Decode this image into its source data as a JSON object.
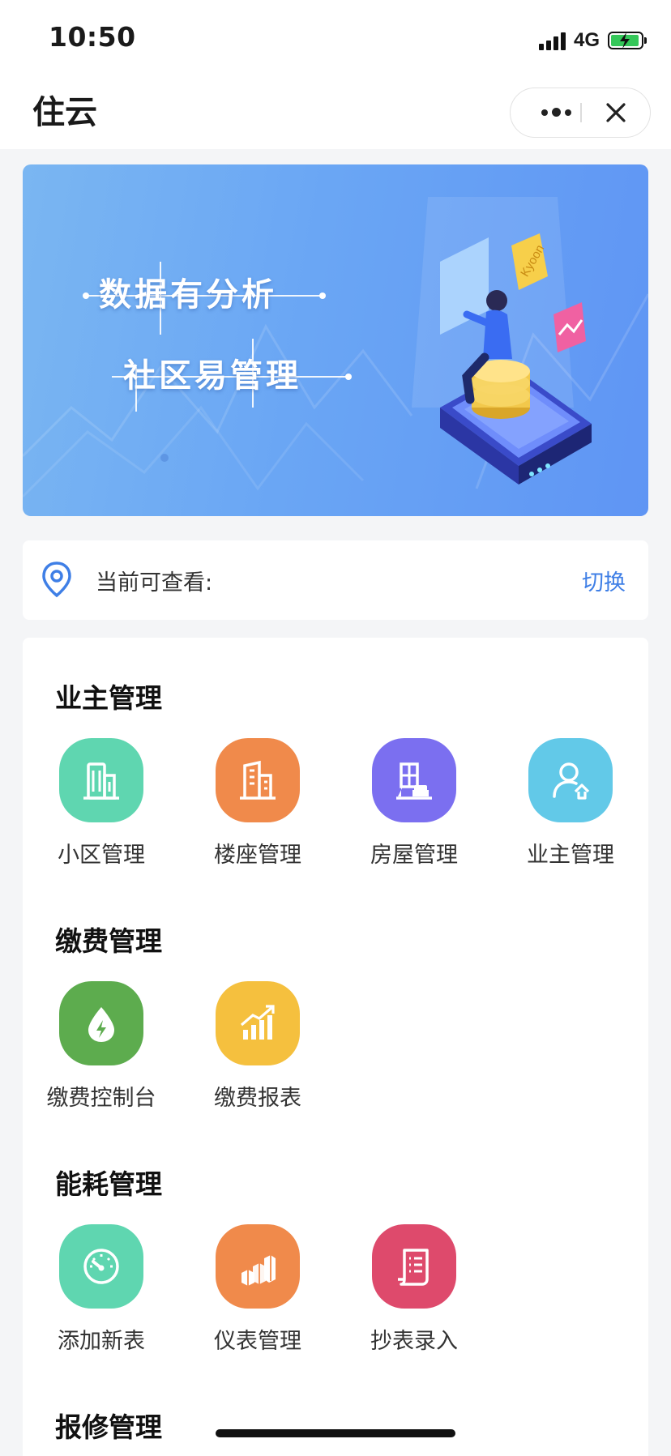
{
  "status_bar": {
    "time": "10:50",
    "network": "4G"
  },
  "nav": {
    "title": "住云"
  },
  "banner": {
    "line1": "数据有分析",
    "line2": "社区易管理",
    "chip_text": "Kyoon"
  },
  "location": {
    "label": "当前可查看:",
    "switch_label": "切换"
  },
  "sections": [
    {
      "title": "业主管理",
      "items": [
        {
          "label": "小区管理",
          "icon": "buildings-icon",
          "color": "#5fd6b0"
        },
        {
          "label": "楼座管理",
          "icon": "building-icon",
          "color": "#f08a4b"
        },
        {
          "label": "房屋管理",
          "icon": "house-sofa-icon",
          "color": "#7b6ff0"
        },
        {
          "label": "业主管理",
          "icon": "owner-user-icon",
          "color": "#62c9e8"
        }
      ]
    },
    {
      "title": "缴费管理",
      "items": [
        {
          "label": "缴费控制台",
          "icon": "energy-drop-icon",
          "color": "#5dac4e"
        },
        {
          "label": "缴费报表",
          "icon": "bar-chart-icon",
          "color": "#f5c03e"
        }
      ]
    },
    {
      "title": "能耗管理",
      "items": [
        {
          "label": "添加新表",
          "icon": "gauge-icon",
          "color": "#5fd6b0"
        },
        {
          "label": "仪表管理",
          "icon": "blocks-icon",
          "color": "#f08a4b"
        },
        {
          "label": "抄表录入",
          "icon": "scroll-list-icon",
          "color": "#de4a6c"
        }
      ]
    },
    {
      "title": "报修管理",
      "items": []
    }
  ]
}
